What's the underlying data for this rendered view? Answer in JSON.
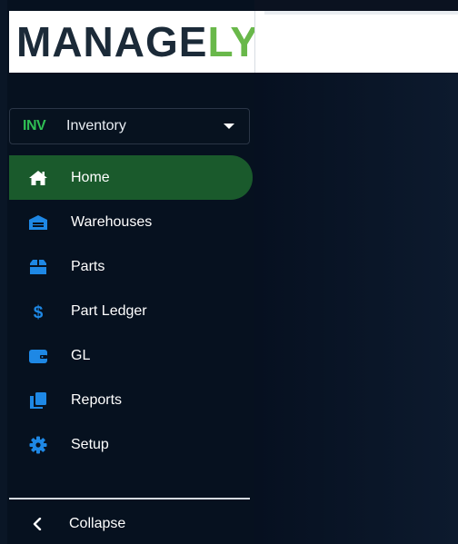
{
  "brand": {
    "logo_main": "MANAGE",
    "logo_accent": "LY",
    "logo_tm": "™"
  },
  "module": {
    "code": "INV",
    "label": "Inventory"
  },
  "nav": {
    "items": [
      {
        "label": "Home",
        "icon": "home-icon",
        "active": true
      },
      {
        "label": "Warehouses",
        "icon": "warehouse-icon",
        "active": false
      },
      {
        "label": "Parts",
        "icon": "box-icon",
        "active": false
      },
      {
        "label": "Part Ledger",
        "icon": "dollar-icon",
        "active": false
      },
      {
        "label": "GL",
        "icon": "wallet-icon",
        "active": false
      },
      {
        "label": "Reports",
        "icon": "copy-icon",
        "active": false
      },
      {
        "label": "Setup",
        "icon": "gear-icon",
        "active": false
      }
    ]
  },
  "footer": {
    "collapse_label": "Collapse"
  },
  "colors": {
    "accent_green": "#1a5a2c",
    "icon_blue": "#1e88e5",
    "module_green": "#2fbf54",
    "sidebar_bg": "#06111f"
  }
}
